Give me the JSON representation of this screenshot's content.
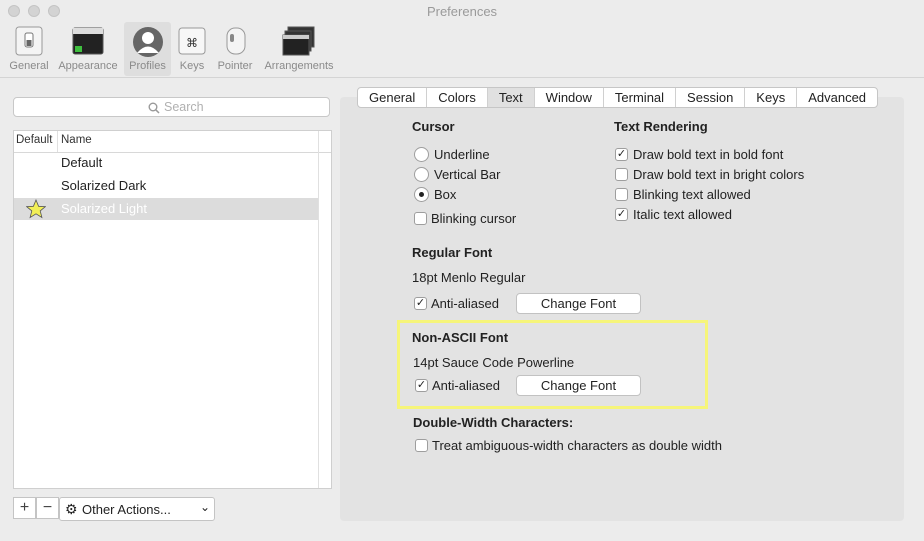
{
  "window": {
    "title": "Preferences"
  },
  "toolbar": {
    "items": [
      {
        "label": "General",
        "icon": "switch-icon"
      },
      {
        "label": "Appearance",
        "icon": "window-icon"
      },
      {
        "label": "Profiles",
        "icon": "profile-icon"
      },
      {
        "label": "Keys",
        "icon": "command-key-icon"
      },
      {
        "label": "Pointer",
        "icon": "mouse-icon"
      },
      {
        "label": "Arrangements",
        "icon": "windows-stack-icon"
      }
    ]
  },
  "sidebar": {
    "search_placeholder": "Search",
    "columns": [
      "Default",
      "Name"
    ],
    "profiles": [
      {
        "name": "Default",
        "default": false,
        "selected": false
      },
      {
        "name": "Solarized Dark",
        "default": false,
        "selected": false
      },
      {
        "name": "Solarized Light",
        "default": true,
        "selected": true
      }
    ],
    "add_label": "+",
    "remove_label": "−",
    "other_actions_label": "Other Actions..."
  },
  "tabs": [
    "General",
    "Colors",
    "Text",
    "Window",
    "Terminal",
    "Session",
    "Keys",
    "Advanced"
  ],
  "active_tab": "Text",
  "cursor": {
    "heading": "Cursor",
    "options": [
      "Underline",
      "Vertical Bar",
      "Box"
    ],
    "selected": "Box",
    "blinking_label": "Blinking cursor",
    "blinking": false
  },
  "text_rendering": {
    "heading": "Text Rendering",
    "options": [
      {
        "label": "Draw bold text in bold font",
        "checked": true
      },
      {
        "label": "Draw bold text in bright colors",
        "checked": false
      },
      {
        "label": "Blinking text allowed",
        "checked": false
      },
      {
        "label": "Italic text allowed",
        "checked": true
      }
    ]
  },
  "regular_font": {
    "heading": "Regular Font",
    "font": "18pt Menlo Regular",
    "anti_aliased_label": "Anti-aliased",
    "anti_aliased": true,
    "change_label": "Change Font"
  },
  "non_ascii_font": {
    "heading": "Non-ASCII Font",
    "font": "14pt Sauce Code Powerline",
    "anti_aliased_label": "Anti-aliased",
    "anti_aliased": true,
    "change_label": "Change Font"
  },
  "double_width": {
    "heading": "Double-Width Characters:",
    "label": "Treat ambiguous-width characters as double width",
    "checked": false
  },
  "colors": {
    "highlight": "#f6f57a"
  }
}
